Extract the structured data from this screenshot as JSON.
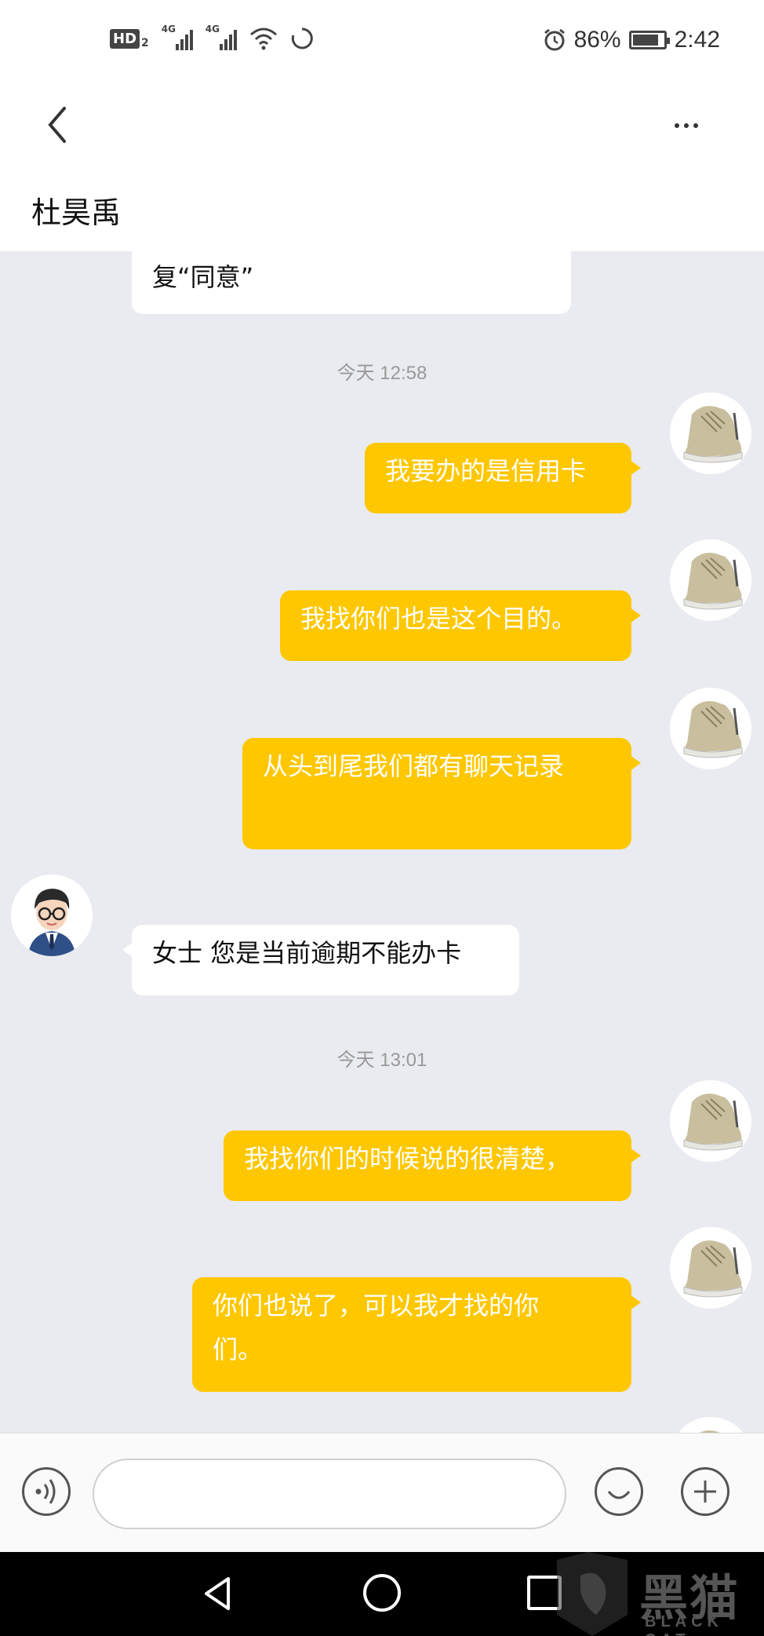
{
  "status_bar": {
    "hd_label": "HD",
    "hd_sub": "2",
    "sig1_label": "4G",
    "sig2_label": "4G",
    "battery_pct": "86%",
    "time": "2:42"
  },
  "header": {
    "title": "杜昊禹",
    "back_icon": "chevron-left-icon",
    "more_icon": "more-dots-icon"
  },
  "chat": {
    "partial_message": "复“同意”",
    "timestamps": [
      "今天 12:58",
      "今天 13:01"
    ],
    "messages_out_1": [
      "我要办的是信用卡",
      "我找你们也是这个目的。",
      "从头到尾我们都有聊天记录"
    ],
    "message_in": "女士 您是当前逾期不能办卡",
    "messages_out_2": [
      "我找你们的时候说的很清楚，",
      "你们也说了，可以我才找的你",
      "们。"
    ]
  },
  "input_bar": {
    "placeholder": "",
    "voice_icon": "voice-icon",
    "emoji_icon": "emoji-icon",
    "plus_icon": "plus-icon"
  },
  "watermark": {
    "text": "黑猫",
    "sub": "BLACK CAT"
  },
  "colors": {
    "bubble_out": "#fec700",
    "chat_bg": "#e9ebf0"
  }
}
